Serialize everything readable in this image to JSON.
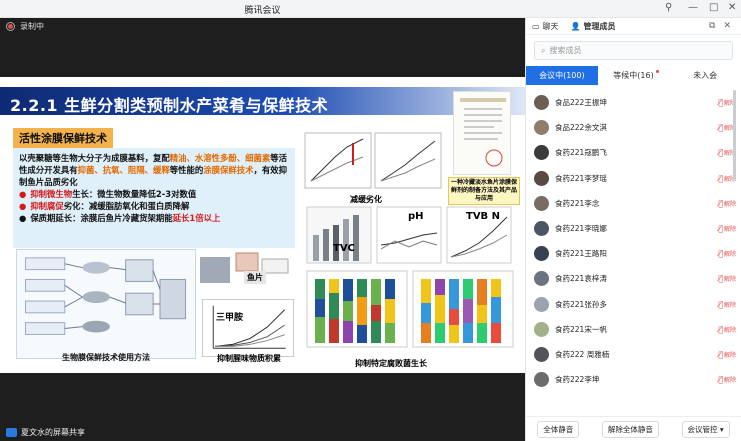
{
  "window": {
    "title": "腾讯会议"
  },
  "recording": {
    "label": "录制中"
  },
  "slide": {
    "title": "2.2.1 生鲜分割类预制水产菜肴与保鲜技术",
    "box_title": "活性涂膜保鲜技术",
    "para_a": "以壳聚糖等生物大分子为成膜基料，复配",
    "para_b": "精油、水溶性多酚、细菌素",
    "para_c": "等活性成分开发具有",
    "para_d": "抑菌、抗氧、阻隔、缓释",
    "para_e": "等性能的",
    "para_f": "涂膜保鲜技术",
    "para_g": "，有效抑制鱼片品质劣化",
    "b1_red": "抑制微生物",
    "b1_rest": "生长：微生物数量降低2-3对数值",
    "b2_red": "抑制腐促",
    "b2_rest": "劣化：减缓脂肪氧化和蛋白质降解",
    "b3_pre": "保质期延长：涂膜后鱼片冷藏货架期能",
    "b3_red": "延长1倍以上",
    "cap_diagram": "生物膜保鲜技术使用方法",
    "fish_label": "鱼片",
    "tma_label": "三甲胺",
    "cap_odor": "抑制腥味物质积累",
    "cap_charts1": "减缓劣化",
    "cert_caption": "一种冷藏淡水鱼片涂膜保鲜剂的制备方法及其产品与应用",
    "tvc": "TVC",
    "ph": "pH",
    "tvbn": "TVB N",
    "cap_bottom": "抑制特定腐败菌生长"
  },
  "share": {
    "label": "夏文水的屏幕共享"
  },
  "panel": {
    "tab_chat": "聊天",
    "tab_members": "管理成员",
    "search_placeholder": "搜索成员",
    "sub_in_meeting": "会议中(100)",
    "sub_waiting": "等候中(16)",
    "sub_not_joined": "未入会",
    "mute_label": "解除",
    "members": [
      {
        "name": "食品222王振坤",
        "color": "#6b5e55"
      },
      {
        "name": "食品222余文淇",
        "color": "#8e7d6a"
      },
      {
        "name": "食药221寇鹏飞",
        "color": "#3b3b3b"
      },
      {
        "name": "食药221李梦瑶",
        "color": "#5a4a42"
      },
      {
        "name": "食药221李念",
        "color": "#7a6c63"
      },
      {
        "name": "食药221李晓娜",
        "color": "#4b5563"
      },
      {
        "name": "食药221王路阳",
        "color": "#374151"
      },
      {
        "name": "食药221袁梓涛",
        "color": "#6b7280"
      },
      {
        "name": "食药221张孙多",
        "color": "#9ca3af"
      },
      {
        "name": "食药221宋一帆",
        "color": "#a3b18a"
      },
      {
        "name": "食药222 周雅楠",
        "color": "#52525b"
      },
      {
        "name": "食药222李坤",
        "color": "#6b6b6b"
      },
      {
        "name": "食药222李梓",
        "color": "#8d8d8d"
      }
    ],
    "btn_mute_all": "全体静音",
    "btn_unmute_all": "解除全体静音",
    "btn_control": "会议管控"
  }
}
